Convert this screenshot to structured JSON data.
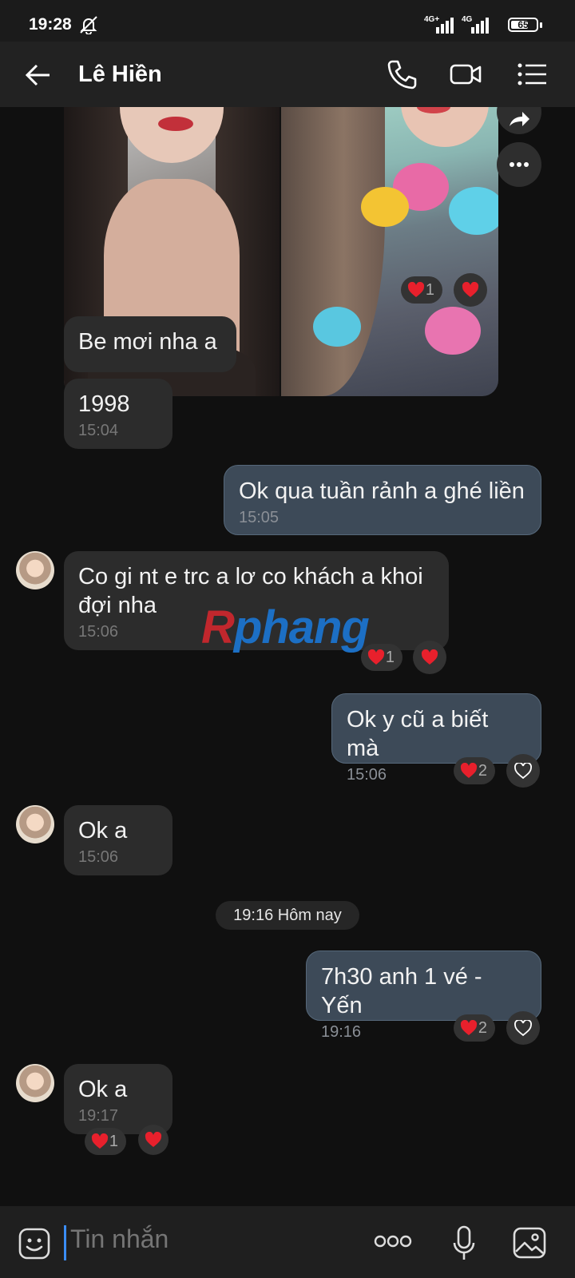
{
  "status": {
    "time": "19:28",
    "network1": "4G+",
    "network2": "4G",
    "battery": "65"
  },
  "header": {
    "contact_name": "Lê Hiền"
  },
  "messages": [
    {
      "text": "Be mơi nha a"
    },
    {
      "text": "1998",
      "time": "15:04"
    },
    {
      "text": "Ok qua tuần rảnh a ghé liền",
      "time": "15:05"
    },
    {
      "text": "Co gi nt e trc a lơ co khách a khoi đợi nha",
      "time": "15:06"
    },
    {
      "text": "Ok y cũ a biết mà",
      "time": "15:06"
    },
    {
      "text": "Ok a",
      "time": "15:06"
    },
    {
      "text": "7h30 anh 1 vé - Yến",
      "time": "19:16"
    },
    {
      "text": "Ok a",
      "time": "19:17"
    }
  ],
  "reactions": {
    "photo": "1",
    "msg4": "1",
    "msg5": "2",
    "msg7": "2",
    "msg8": "1"
  },
  "date_divider": "19:16 Hôm nay",
  "watermark": {
    "part1": "R",
    "part2": "phang"
  },
  "input": {
    "placeholder": "Tin nhắn"
  },
  "colors": {
    "accent": "#3b8df5",
    "heart": "#e8202c",
    "outgoing_bubble": "#3d4a58",
    "incoming_bubble": "#2c2c2c"
  }
}
